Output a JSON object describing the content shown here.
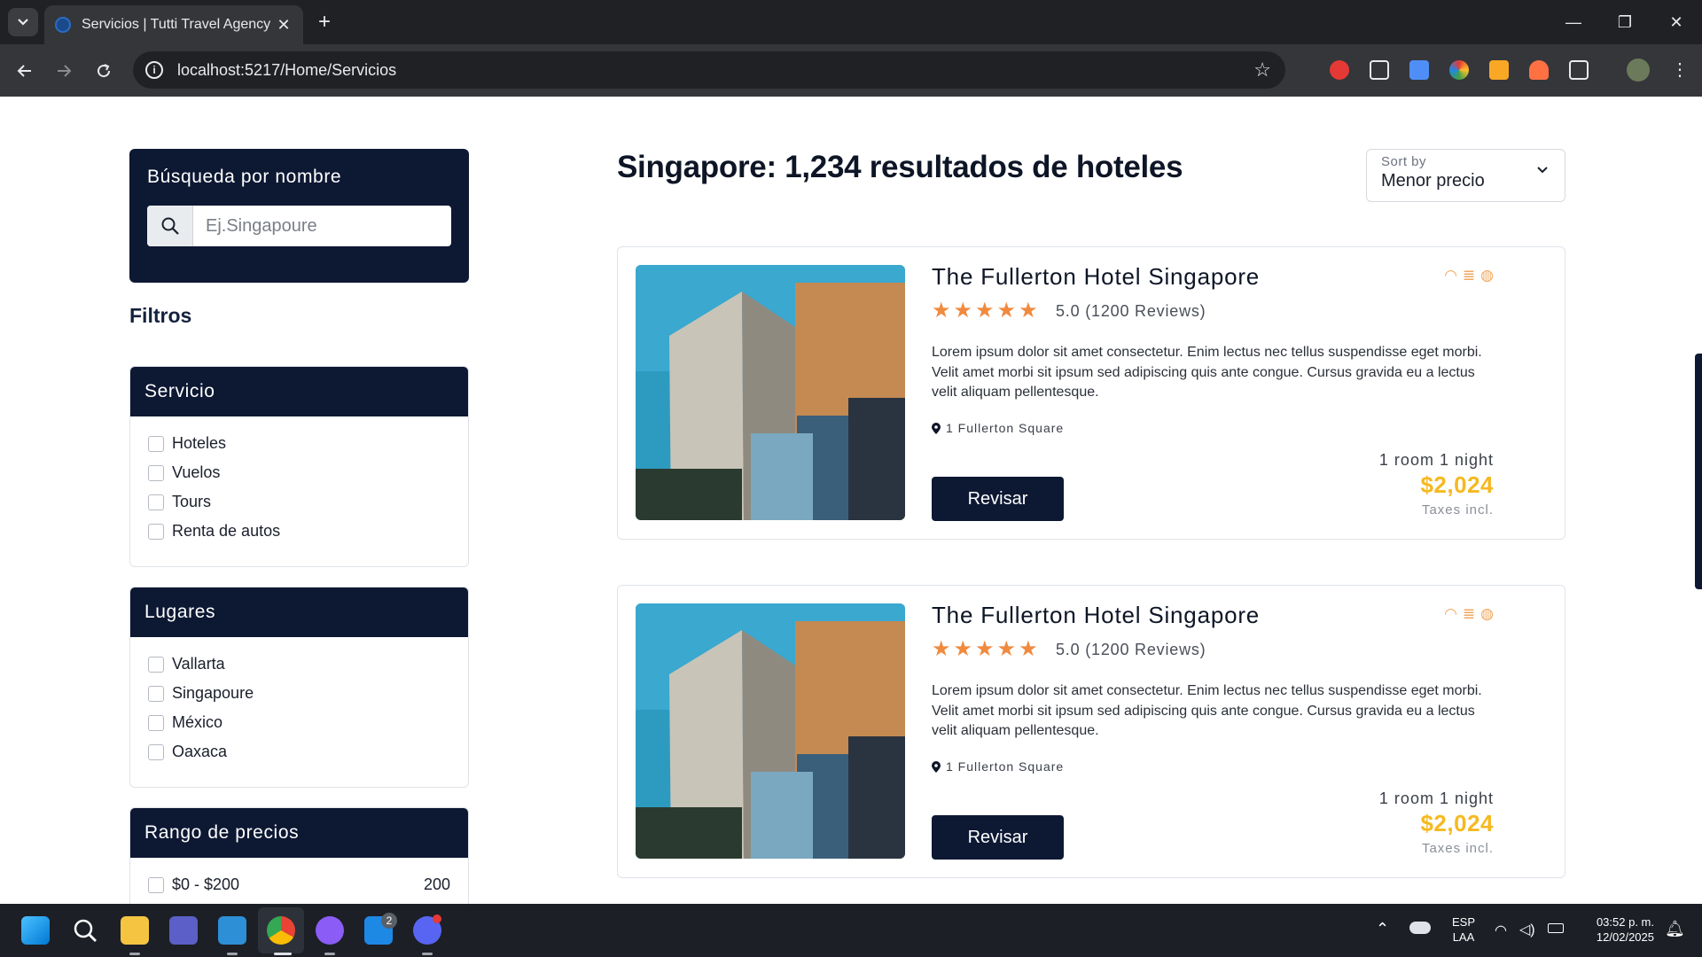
{
  "browser": {
    "tab_title": "Servicios | Tutti Travel Agency",
    "url": "localhost:5217/Home/Servicios"
  },
  "search": {
    "title": "Búsqueda por nombre",
    "placeholder": "Ej.Singapoure"
  },
  "filters": {
    "title": "Filtros",
    "servicio": {
      "title": "Servicio",
      "options": [
        "Hoteles",
        "Vuelos",
        "Tours",
        "Renta de autos"
      ]
    },
    "lugares": {
      "title": "Lugares",
      "options": [
        "Vallarta",
        "Singapoure",
        "México",
        "Oaxaca"
      ]
    },
    "precios": {
      "title": "Rango de precios",
      "options": [
        {
          "label": "$0 - $200",
          "count": "200"
        }
      ]
    }
  },
  "results": {
    "title": "Singapore: 1,234 resultados de hoteles",
    "sort_label": "Sort by",
    "sort_value": "Menor precio"
  },
  "hotels": [
    {
      "name": "The Fullerton Hotel Singapore",
      "rating": "5.0 (1200 Reviews)",
      "stars": 5,
      "description": "Lorem ipsum dolor sit amet consectetur. Enim lectus nec tellus suspendisse eget morbi. Velit amet morbi sit ipsum sed adipiscing quis ante congue. Cursus gravida eu a lectus velit aliquam pellentesque.",
      "address": "1 Fullerton Square",
      "button": "Revisar",
      "room_night": "1 room 1 night",
      "price": "$2,024",
      "taxes": "Taxes incl."
    },
    {
      "name": "The Fullerton Hotel Singapore",
      "rating": "5.0 (1200 Reviews)",
      "stars": 5,
      "description": "Lorem ipsum dolor sit amet consectetur. Enim lectus nec tellus suspendisse eget morbi. Velit amet morbi sit ipsum sed adipiscing quis ante congue. Cursus gravida eu a lectus velit aliquam pellentesque.",
      "address": "1 Fullerton Square",
      "button": "Revisar",
      "room_night": "1 room 1 night",
      "price": "$2,024",
      "taxes": "Taxes incl."
    }
  ],
  "taskbar": {
    "lang_line1": "ESP",
    "lang_line2": "LAA",
    "time": "03:52 p. m.",
    "date": "12/02/2025",
    "store_badge": "2"
  },
  "colors": {
    "navy": "#0d1833",
    "star_orange": "#f08a3e",
    "price_yellow": "#f5b920"
  }
}
